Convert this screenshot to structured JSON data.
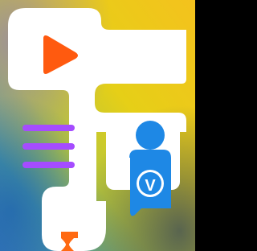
{
  "colors": {
    "play": "#ff5a0f",
    "white_lines": "#ffffff",
    "purple_lines": "#a54cff",
    "blue_icon": "#1e88e5",
    "badge_letter": "#ffffff",
    "hourglass": "#ff6a12",
    "panel": "#ffffff"
  },
  "icons": {
    "play": "play-icon",
    "menu_top": "menu-lines-icon",
    "menu_bottom": "menu-lines-icon",
    "profile": "user-profile-icon",
    "badge": "verified-badge-icon",
    "timer": "hourglass-icon"
  },
  "badge": {
    "letter": "V"
  }
}
